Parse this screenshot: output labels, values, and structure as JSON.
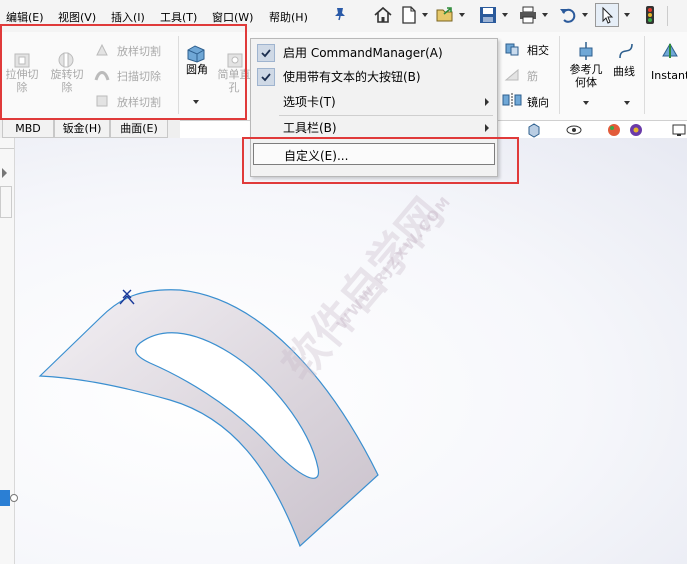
{
  "menubar": {
    "items": [
      "编辑(E)",
      "视图(V)",
      "插入(I)",
      "工具(T)",
      "窗口(W)",
      "帮助(H)"
    ]
  },
  "ribbon": {
    "extrude_cut": "拉伸切\n除",
    "revolve_cut": "旋转切\n除",
    "lofted_cut": "放样切割",
    "swept_cut": "扫描切除",
    "boundary_cut": "放样切割",
    "fillet": "圆角",
    "simple_hole": "简单直\n孔",
    "intersect": "相交",
    "rib": "筋",
    "mirror": "镜向",
    "ref_geometry": "参考几\n何体",
    "curves": "曲线",
    "instant3d": "Instant"
  },
  "tabs": [
    "MBD",
    "钣金(H)",
    "曲面(E)"
  ],
  "dropdown": {
    "item1": "启用 CommandManager(A)",
    "item2": "使用带有文本的大按钮(B)",
    "item3": "选项卡(T)",
    "item4": "工具栏(B)",
    "item5": "自定义(E)..."
  },
  "watermark": {
    "cn": "软件自学网",
    "url": "WWW.RJZXW.COM"
  },
  "colors": {
    "highlight_red": "#e03a3a",
    "part_edge": "#3a8fd0",
    "part_fill": "#d9d4dc"
  },
  "icons": [
    "home-icon",
    "new-document-icon",
    "open-icon",
    "save-icon",
    "print-icon",
    "undo-icon",
    "select-cursor-icon",
    "traffic-light-icon"
  ]
}
